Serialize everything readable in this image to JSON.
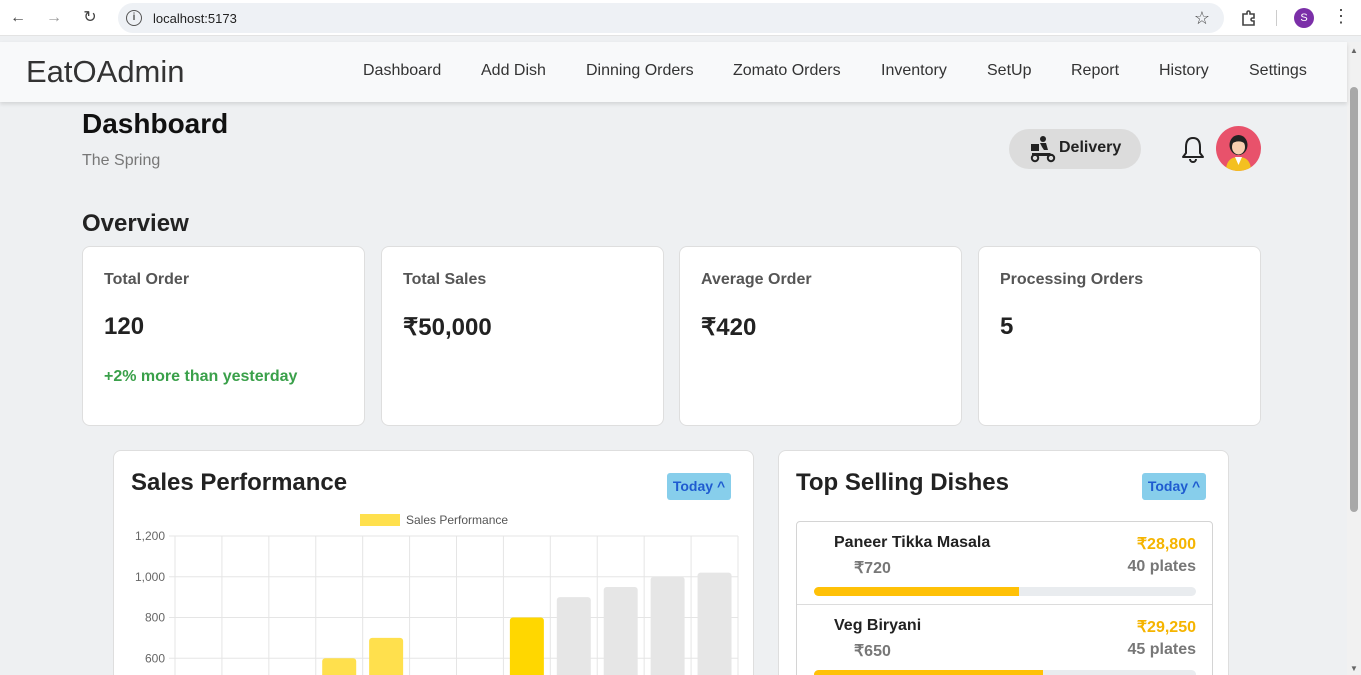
{
  "browser": {
    "url": "localhost:5173",
    "profile_initial": "S"
  },
  "nav": {
    "brand": "EatOAdmin",
    "items": [
      "Dashboard",
      "Add Dish",
      "Dinning Orders",
      "Zomato Orders",
      "Inventory",
      "SetUp",
      "Report",
      "History",
      "Settings"
    ]
  },
  "header": {
    "title": "Dashboard",
    "subtitle": "The Spring",
    "delivery_label": "Delivery"
  },
  "overview": {
    "title": "Overview",
    "cards": [
      {
        "title": "Total Order",
        "value": "120",
        "delta": "+2% more than yesterday"
      },
      {
        "title": "Total Sales",
        "value": "₹50,000",
        "delta": ""
      },
      {
        "title": "Average Order",
        "value": "₹420",
        "delta": ""
      },
      {
        "title": "Processing Orders",
        "value": "5",
        "delta": ""
      }
    ]
  },
  "sales": {
    "title": "Sales Performance",
    "filter": "Today ^"
  },
  "top_dishes": {
    "title": "Top Selling Dishes",
    "filter": "Today ^",
    "items": [
      {
        "name": "Paneer Tikka Masala",
        "price": "₹720",
        "total": "₹28,800",
        "qty": "40 plates",
        "share": 0.536
      },
      {
        "name": "Veg Biryani",
        "price": "₹650",
        "total": "₹29,250",
        "qty": "45 plates",
        "share": 0.6
      }
    ]
  },
  "colors": {
    "accent": "#ffc107",
    "bar_yellow": "#ffe04d",
    "bar_highlight": "#ffd700",
    "bar_gray": "#e6e6e6",
    "delta_green": "#3aa04a",
    "filter_bg": "#87ceeb"
  },
  "chart_data": {
    "type": "bar",
    "legend": [
      "Sales Performance"
    ],
    "legend_position": "top",
    "grid": true,
    "yticks": [
      "1,200",
      "1,000",
      "800",
      "600"
    ],
    "ylim": [
      500,
      1200
    ],
    "values": [
      null,
      null,
      null,
      600,
      700,
      null,
      null,
      800,
      900,
      950,
      1000,
      1020
    ],
    "bar_roles": [
      "",
      "",
      "",
      "yellow",
      "yellow",
      "",
      "",
      "highlight",
      "gray",
      "gray",
      "gray",
      "gray"
    ]
  }
}
